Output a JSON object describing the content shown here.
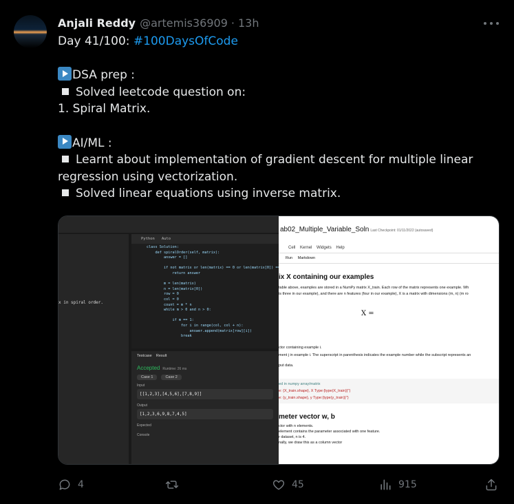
{
  "author": {
    "name": "Anjali Reddy",
    "handle": "@artemis36909",
    "separator": "·",
    "time": "13h"
  },
  "tweet": {
    "line1_prefix": "Day 41/100: ",
    "hashtag": "#100DaysOfCode",
    "dsa_heading": "DSA prep :",
    "dsa_item": "Solved leetcode question on:",
    "dsa_problem": "1. Spiral Matrix.",
    "ml_heading": "AI/ML :",
    "ml_item1_a": "Learnt about implementation of gradient descent for multiple linear",
    "ml_item1_b": "regression using vectorization.",
    "ml_item2": "Solved linear equations using inverse matrix."
  },
  "image": {
    "leetcode": {
      "lang": "Python",
      "auto": "Auto",
      "desc": "x in spiral order.",
      "code": "class Solution:\n    def spiralOrder(self, matrix):\n        answer = []\n\n        if not matrix or len(matrix) == 0 or len(matrix[0]) == 0:\n            return answer\n\n        m = len(matrix)\n        n = len(matrix[0])\n        row = 0\n        col = 0\n        count = m * n\n        while m > 0 and n > 0:\n\n            if m == 1:\n                for i in range(col, col + n):\n                    answer.append(matrix[row][i])\n                break",
      "tab_testcase": "Testcase",
      "tab_result": "Result",
      "status": "Accepted",
      "runtime": "Runtime: 26 ms",
      "case1": "Case 1",
      "case2": "Case 2",
      "input_label": "Input",
      "input_value": "[[1,2,3],[4,5,6],[7,8,9]]",
      "output_label": "Output",
      "output_value": "[1,2,3,6,9,8,7,4,5]",
      "expected_label": "Expected",
      "console": "Console"
    },
    "jupyter": {
      "title": "ab02_Multiple_Variable_Soln",
      "checkpoint": "Last Checkpoint: 01/11/2022 (autosaved)",
      "menu": [
        "Cell",
        "Kernel",
        "Widgets",
        "Help"
      ],
      "run": "Run",
      "celltype": "Markdown",
      "heading1": "ix X containing our examples",
      "para1": "table above, examples are stored in a NumPy matrix X_train. Each row of the matrix represents one example. Wh",
      "para2": "is three in our example), and there are n features (four in our example), X is a matrix with dimensions (m, n) (m ro",
      "matrix_label": "X =",
      "para3": "ctor containing example i.",
      "para4": "ment j in example i. The superscript in parenthesis indicates the example number while the subscript represents an",
      "para5": "put data.",
      "code1": "ed in numpy array/matrix",
      "code2": "e: {X_train.shape}, X Type:{type(X_train)}\")",
      "code3": "e: {y_train.shape}, y Type:{type(y_train)}\")",
      "heading2": "meter vector w, b",
      "para6": "ctor with n elements.",
      "para7": "element contains the parameter associated with one feature.",
      "para8": "r dataset, n is 4.",
      "para9": "nally, we draw this as a column vector"
    }
  },
  "actions": {
    "replies": "4",
    "reposts": "",
    "likes": "45",
    "views": "915"
  }
}
